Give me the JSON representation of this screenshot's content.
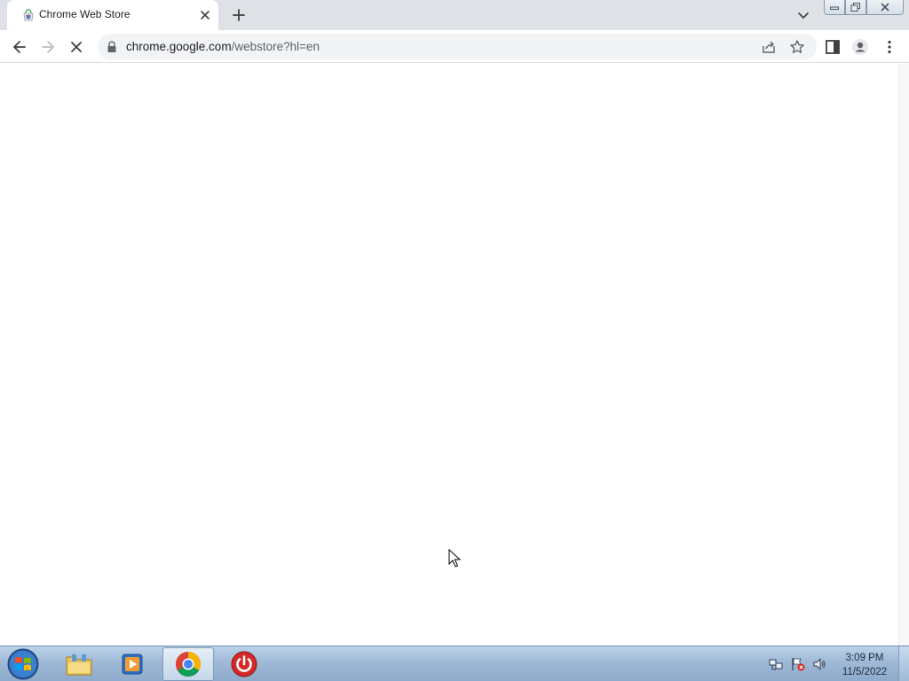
{
  "browser": {
    "tab": {
      "title": "Chrome Web Store"
    },
    "address": {
      "host": "chrome.google.com",
      "path": "/webstore?hl=en"
    }
  },
  "taskbar": {
    "clock": {
      "time": "3:09 PM",
      "date": "11/5/2022"
    }
  },
  "colors": {
    "tabstrip": "#dee1e6",
    "omnibox": "#f1f3f4",
    "taskbar": "#9fb9d6"
  },
  "icons": {
    "tab": [
      "chrome-web-store-favicon",
      "close-icon",
      "plus-icon",
      "chevron-down-icon"
    ],
    "toolbar": [
      "back-arrow-icon",
      "forward-arrow-icon",
      "loading-spinner-icon",
      "lock-icon",
      "share-icon",
      "star-icon",
      "side-panel-icon",
      "profile-icon",
      "kebab-menu-icon"
    ],
    "taskbar": [
      "windows-start-icon",
      "file-explorer-icon",
      "media-player-icon",
      "chrome-icon",
      "power-icon",
      "network-icon",
      "action-center-flag-icon",
      "speaker-icon"
    ]
  }
}
